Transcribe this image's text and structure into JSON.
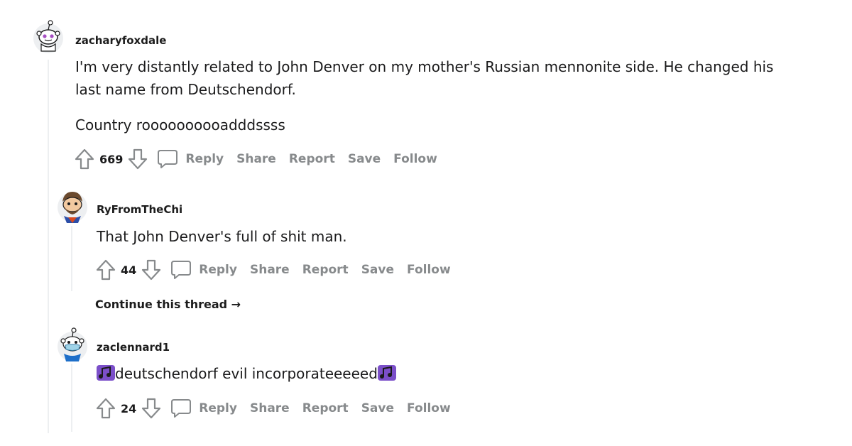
{
  "colors": {
    "text": "#1a1a1b",
    "muted": "#878a8c",
    "thread_line": "#edeff1",
    "emoji_purple": "#7b4fc9"
  },
  "comments": [
    {
      "username": "zacharyfoxdale",
      "avatar_icon": "snoo-avatar-icon",
      "body": [
        "I'm very distantly related to John Denver on my mother's Russian mennonite side. He changed his",
        "last name from Deutschendorf.",
        "Country roooooooooadddssss"
      ],
      "votes": "669",
      "actions": {
        "reply": "Reply",
        "share": "Share",
        "report": "Report",
        "save": "Save",
        "follow": "Follow"
      }
    },
    {
      "username": "RyFromTheChi",
      "avatar_icon": "bearded-snoo-avatar-icon",
      "body": [
        "That John Denver's full of shit man."
      ],
      "votes": "44",
      "actions": {
        "reply": "Reply",
        "share": "Share",
        "report": "Report",
        "save": "Save",
        "follow": "Follow"
      },
      "continue_label": "Continue this thread →"
    },
    {
      "username": "zaclennard1",
      "avatar_icon": "masked-snoo-avatar-icon",
      "body": [
        "deutschendorf evil incorporateeeeed"
      ],
      "votes": "24",
      "actions": {
        "reply": "Reply",
        "share": "Share",
        "report": "Report",
        "save": "Save",
        "follow": "Follow"
      }
    }
  ]
}
